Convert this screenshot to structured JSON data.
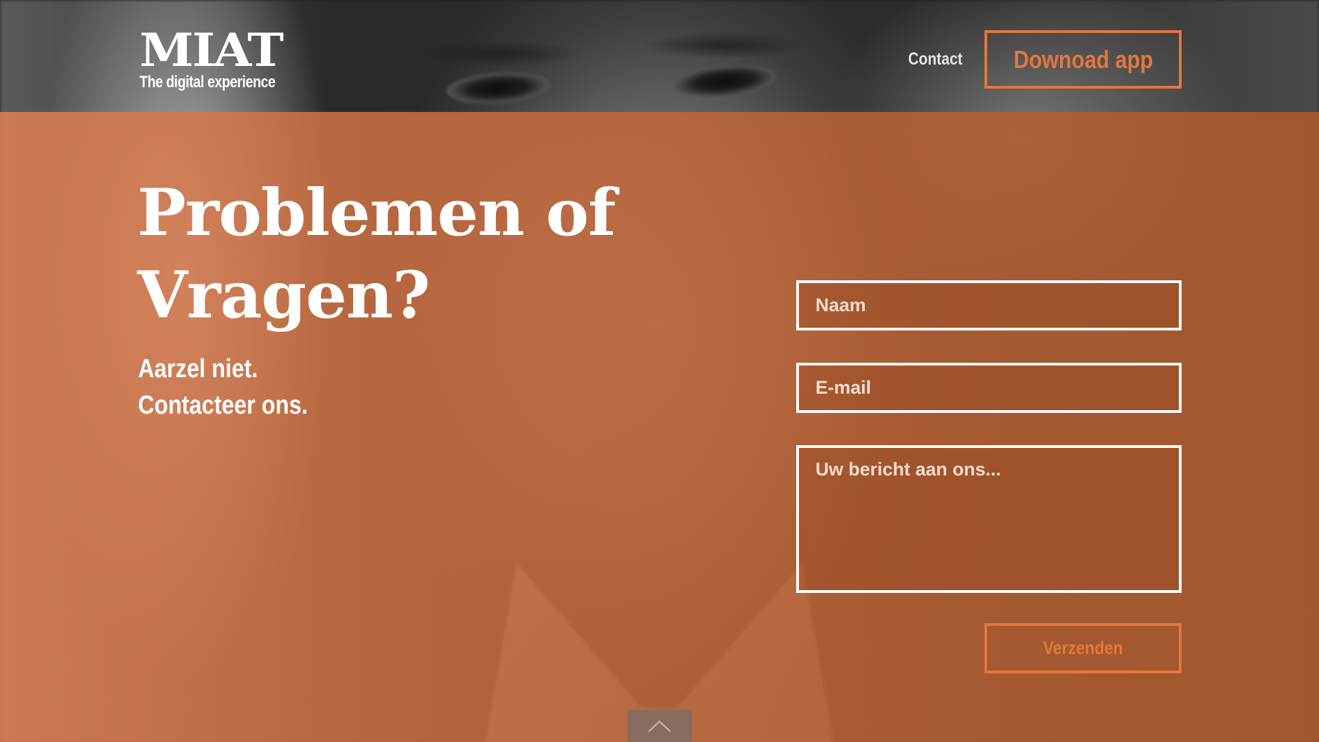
{
  "header": {
    "logo_word": "MIAT",
    "logo_tagline": "The digital experience",
    "nav_contact": "Contact",
    "download_label": "Downoad app"
  },
  "hero": {
    "headline_line1": "Problemen of",
    "headline_line2": "Vragen?",
    "sub_line1": "Aarzel niet.",
    "sub_line2": "Contacteer ons."
  },
  "form": {
    "name_placeholder": "Naam",
    "email_placeholder": "E-mail",
    "message_placeholder": "Uw bericht aan ons...",
    "submit_label": "Verzenden"
  },
  "icons": {
    "scroll_top": "chevron-up-icon"
  },
  "colors": {
    "accent": "#e4773c",
    "overlay": "#c8693a",
    "text": "#ffffff"
  }
}
